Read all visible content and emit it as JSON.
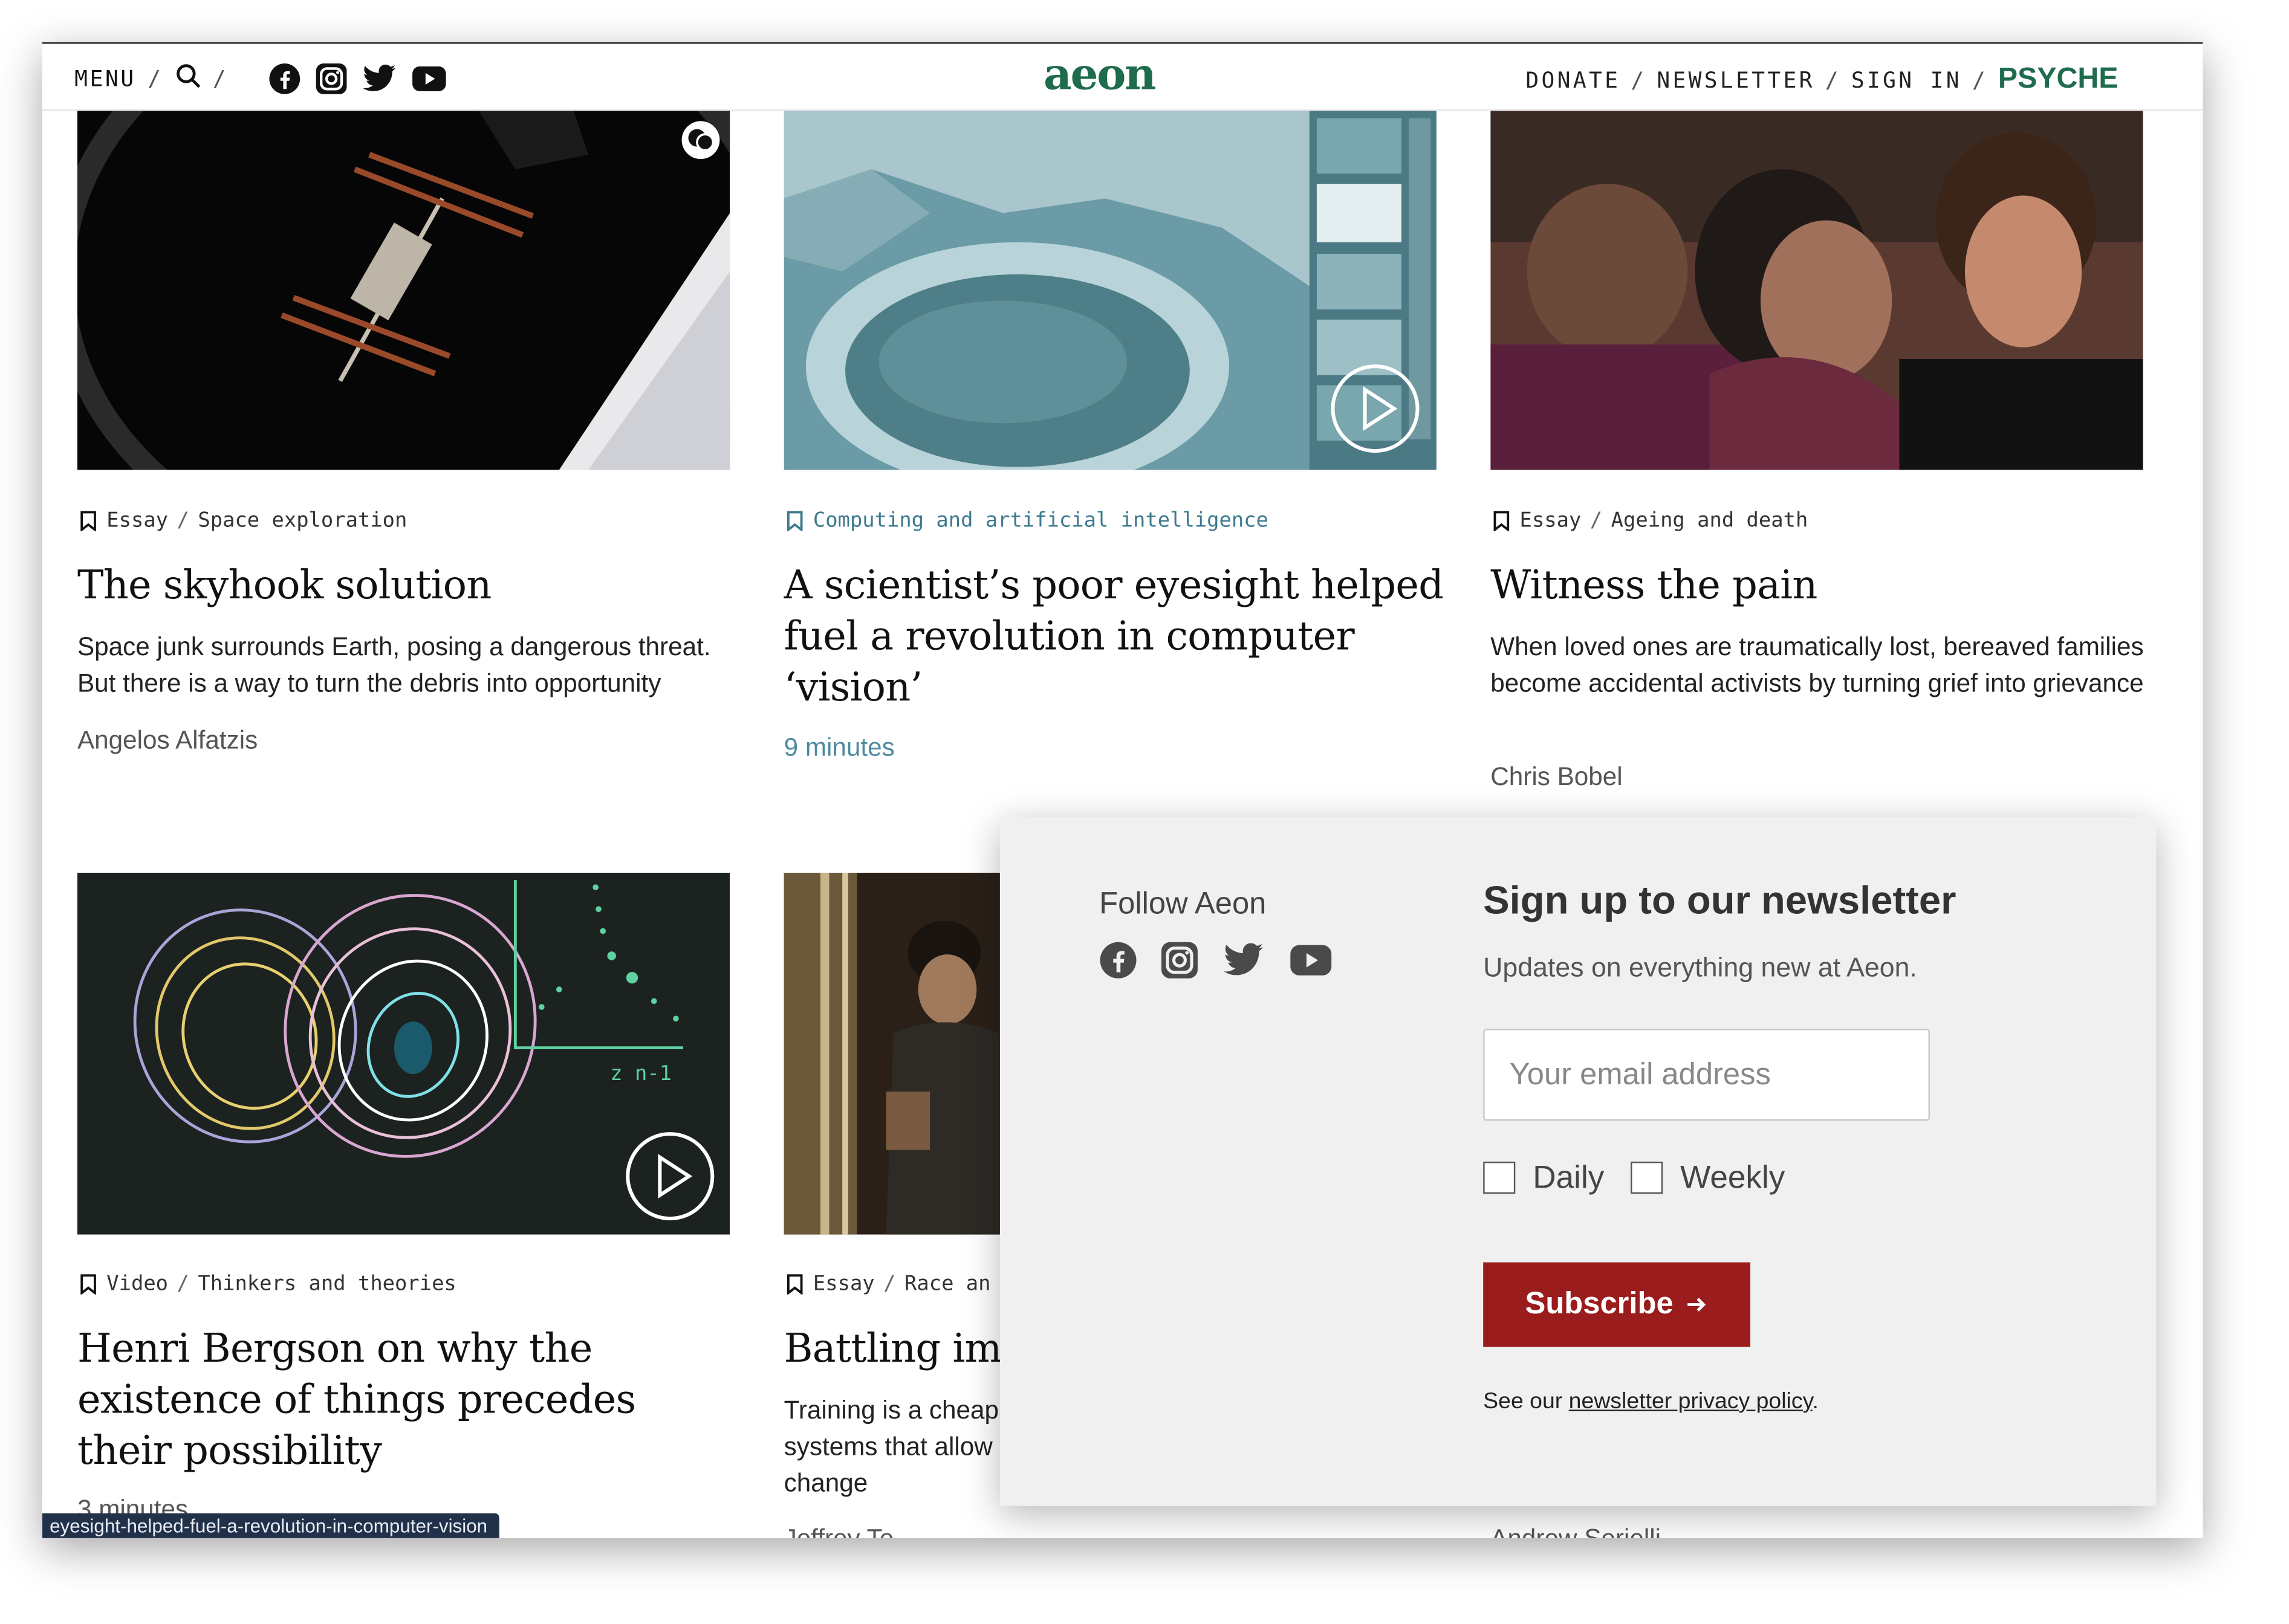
{
  "header": {
    "menu_label": "MENU",
    "nav_right": [
      "DONATE",
      "NEWSLETTER",
      "SIGN IN"
    ],
    "psyche_label": "PSYCHE",
    "logo_text": "aeon",
    "brand_color": "#1f6b4d",
    "social_icons": [
      "facebook-icon",
      "instagram-icon",
      "twitter-icon",
      "youtube-icon"
    ]
  },
  "articles": [
    {
      "type": "Essay",
      "topic": "Space exploration",
      "title": "The skyhook solution",
      "description": "Space junk surrounds Earth, posing a dangerous threat. But there is a way to turn the debris into opportunity",
      "author": "Angelos Alfatzis"
    },
    {
      "type": "",
      "topic": "Computing and artificial intelligence",
      "title": "A scientist’s poor eyesight helped fuel a revolution in computer ‘vision’",
      "description": "",
      "author": "9 minutes"
    },
    {
      "type": "Essay",
      "topic": "Ageing and death",
      "title": "Witness the pain",
      "description": "When loved ones are traumatically lost, bereaved families become accidental activists by turning grief into grievance",
      "author": "Chris Bobel"
    },
    {
      "type": "Video",
      "topic": "Thinkers and theories",
      "title": "Henri Bergson on why the existence of things precedes their possibility",
      "description": "",
      "author": "3 minutes"
    },
    {
      "type": "Essay",
      "topic": "Race an",
      "title": "Battling im",
      "description": "Training is a cheap systems that allow change",
      "author": "Jeffrey Te"
    },
    {
      "author": "Andrew Serielli"
    }
  ],
  "newsletter": {
    "follow_label": "Follow Aeon",
    "title": "Sign up to our newsletter",
    "subtitle": "Updates on everything new at Aeon.",
    "email_placeholder": "Your email address",
    "daily_label": "Daily",
    "weekly_label": "Weekly",
    "subscribe_label": "Subscribe",
    "privacy_prefix": "See our",
    "privacy_link": "newsletter privacy policy",
    "privacy_suffix": ".",
    "button_color": "#9b1c1c"
  },
  "status_url": "eyesight-helped-fuel-a-revolution-in-computer-vision"
}
